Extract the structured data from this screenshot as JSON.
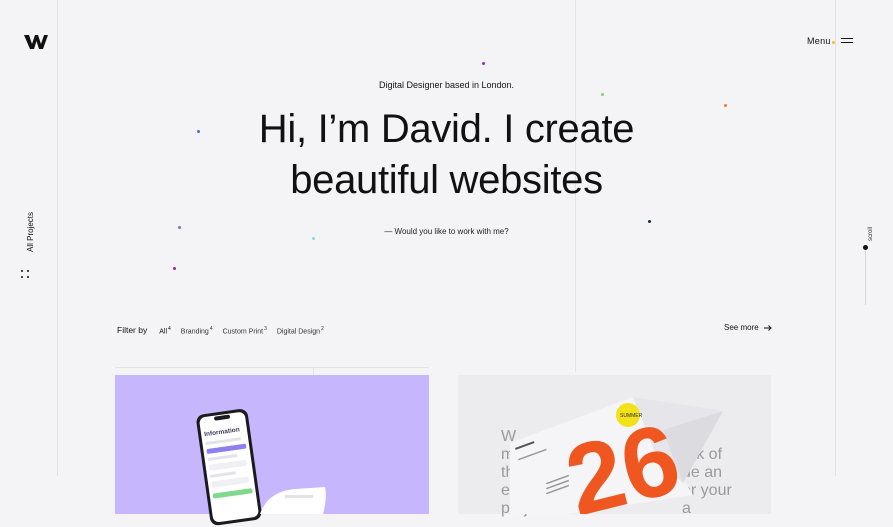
{
  "header": {
    "logo_label": "W",
    "menu_label": "Menu"
  },
  "side": {
    "label": "All Projects",
    "scroll_label": "scroll"
  },
  "hero": {
    "subtitle": "Digital Designer based in London.",
    "headline_line1": "Hi, I’m David. I create",
    "headline_line2": "beautiful websites",
    "tagline": "— Would you like to work with me?"
  },
  "filter": {
    "label": "Filter by",
    "chips": [
      {
        "label": "All",
        "count": "4"
      },
      {
        "label": "Branding",
        "count": "4"
      },
      {
        "label": "Custom Print",
        "count": "3"
      },
      {
        "label": "Digital Design",
        "count": "2"
      }
    ],
    "see_more": "See more"
  },
  "cards": [
    {
      "name": "app-project",
      "screen_title": "Information",
      "color": "#c6b6fd"
    },
    {
      "name": "magazine-project",
      "number": "26",
      "badge": "SUMMER",
      "bg_text_lines": [
        "W",
        "m",
        "the",
        "exc",
        "proje"
      ],
      "bg_text_right": [
        "ally",
        "ork of",
        "de an",
        "er your",
        "a"
      ],
      "color": "#ececee"
    }
  ],
  "colors": {
    "background": "#f4f4f6",
    "accent_yellow": "#f2c315",
    "card_lavender": "#c6b6fd",
    "magazine_orange": "#f0561f"
  }
}
